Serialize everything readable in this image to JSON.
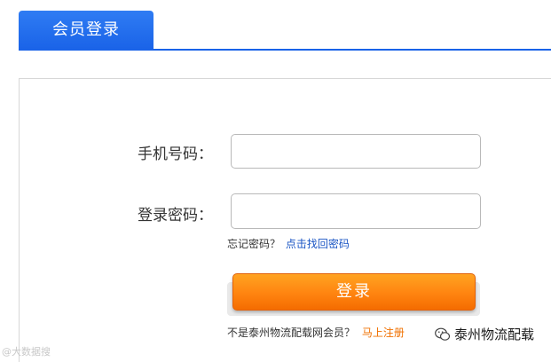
{
  "tab": {
    "label": "会员登录"
  },
  "form": {
    "phone_label": "手机号码：",
    "phone_value": "",
    "password_label": "登录密码：",
    "password_value": "",
    "forgot_text": "忘记密码？",
    "forgot_link": "点击找回密码",
    "login_button": "登录",
    "register_text": "不是泰州物流配载网会员？",
    "register_link": "马上注册"
  },
  "watermarks": {
    "left": "@大数据搜",
    "right": "泰州物流配载"
  },
  "colors": {
    "tab_blue": "#1a63e8",
    "button_orange": "#ff8410",
    "link_blue": "#1a55c4",
    "link_orange": "#f07000"
  }
}
